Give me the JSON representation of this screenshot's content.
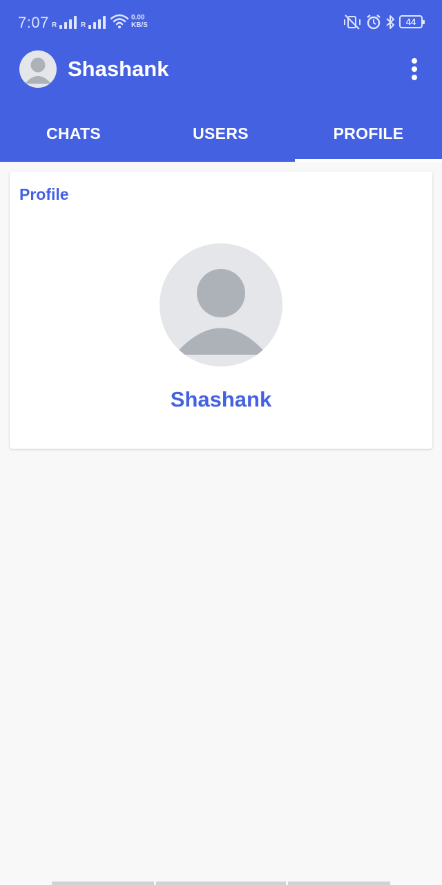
{
  "status_bar": {
    "time": "7:07",
    "signal_1_label": "R",
    "signal_2_label": "R",
    "speed_value": "0.00",
    "speed_unit": "KB/S",
    "battery": "44"
  },
  "header": {
    "title": "Shashank",
    "avatar_icon": "person-avatar-icon",
    "menu_icon": "more-vert-icon"
  },
  "tabs": [
    {
      "label": "CHATS",
      "selected": false
    },
    {
      "label": "USERS",
      "selected": false
    },
    {
      "label": "PROFILE",
      "selected": true
    }
  ],
  "profile_card": {
    "title": "Profile",
    "name": "Shashank",
    "avatar_icon": "person-avatar-icon"
  },
  "colors": {
    "primary": "#4461e2",
    "background": "#f8f8f8",
    "avatar_bg": "#e4e6e9",
    "avatar_fg": "#acb2b8"
  }
}
